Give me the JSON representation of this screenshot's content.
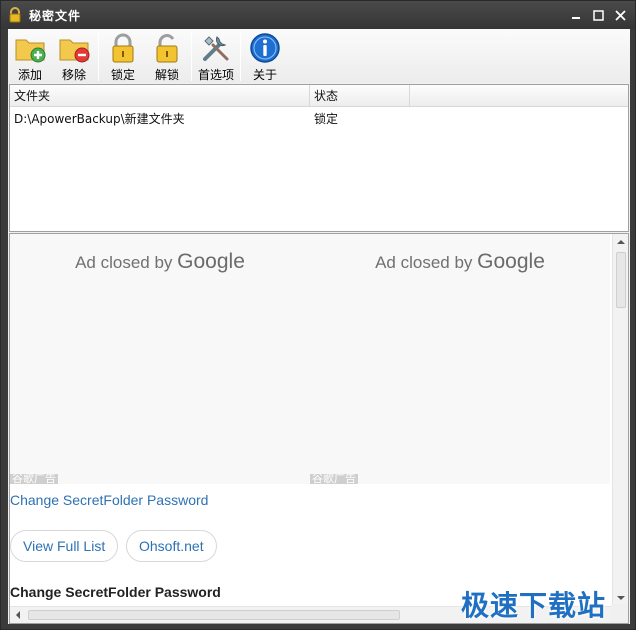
{
  "window": {
    "title": "秘密文件",
    "controls": {
      "minimize_icon": "minimize-icon",
      "maximize_icon": "maximize-icon",
      "close_icon": "close-icon"
    }
  },
  "toolbar": {
    "items": [
      {
        "label": "添加",
        "icon": "folder-add-icon"
      },
      {
        "label": "移除",
        "icon": "folder-remove-icon"
      },
      {
        "label": "锁定",
        "icon": "lock-icon"
      },
      {
        "label": "解锁",
        "icon": "unlock-icon"
      },
      {
        "label": "首选项",
        "icon": "tools-icon"
      },
      {
        "label": "关于",
        "icon": "info-icon"
      }
    ]
  },
  "folder_list": {
    "columns": [
      "文件夹",
      "状态"
    ],
    "rows": [
      {
        "folder": "D:\\ApowerBackup\\新建文件夹",
        "status": "锁定"
      }
    ]
  },
  "browser": {
    "ads": [
      {
        "closed_prefix": "Ad closed by",
        "brand": "Google",
        "label": "谷歌广告"
      },
      {
        "closed_prefix": "Ad closed by",
        "brand": "Google",
        "label": "谷歌广告"
      }
    ],
    "link_title": "Change SecretFolder Password",
    "buttons": {
      "view_full_list": "View Full List",
      "ohsoft": "Ohsoft.net"
    },
    "section_title": "Change SecretFolder Password"
  },
  "watermark": "极速下载站",
  "colors": {
    "link": "#2d72b3",
    "watermark": "#1f6fc2",
    "titlebar": "#3a3a3a"
  }
}
